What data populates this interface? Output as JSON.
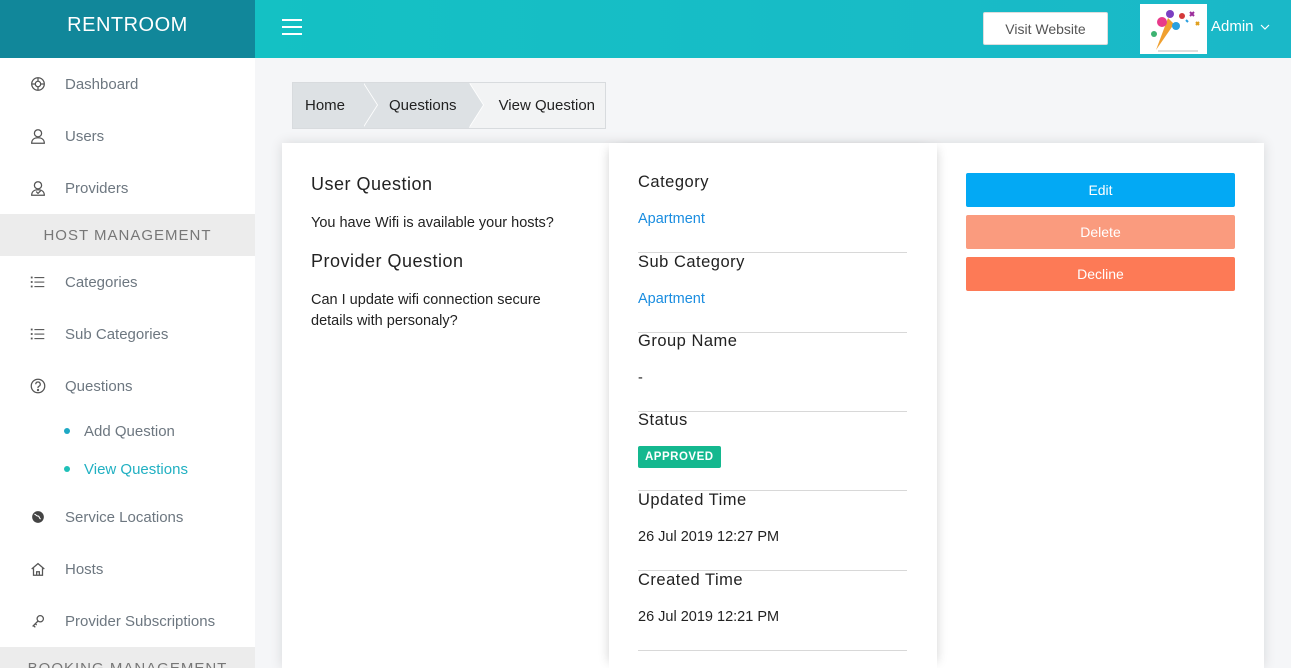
{
  "brand": "RENTROOM",
  "topbar": {
    "visit_website": "Visit Website",
    "admin_label": "Admin"
  },
  "sidebar": {
    "items_top": [
      {
        "label": "Dashboard",
        "icon": "dashboard-icon"
      },
      {
        "label": "Users",
        "icon": "user-icon"
      },
      {
        "label": "Providers",
        "icon": "provider-icon"
      }
    ],
    "host_management": "HOST MANAGEMENT",
    "items_host": [
      {
        "label": "Categories",
        "icon": "list-icon"
      },
      {
        "label": "Sub Categories",
        "icon": "list-icon"
      },
      {
        "label": "Questions",
        "icon": "question-icon"
      }
    ],
    "sub_items": [
      {
        "label": "Add Question"
      },
      {
        "label": "View Questions"
      }
    ],
    "items_more": [
      {
        "label": "Service Locations",
        "icon": "globe-icon"
      },
      {
        "label": "Hosts",
        "icon": "home-icon"
      },
      {
        "label": "Provider Subscriptions",
        "icon": "key-icon"
      }
    ],
    "booking_management": "BOOKING MANAGEMENT"
  },
  "breadcrumb": [
    "Home",
    "Questions",
    "View Question"
  ],
  "question": {
    "user_question_title": "User Question",
    "user_question": "You have Wifi is available your hosts?",
    "provider_question_title": "Provider Question",
    "provider_question": "Can I update wifi connection secure details with personaly?"
  },
  "details": {
    "category_label": "Category",
    "category": "Apartment",
    "sub_category_label": "Sub Category",
    "sub_category": "Apartment",
    "group_name_label": "Group Name",
    "group_name": "-",
    "status_label": "Status",
    "status": "APPROVED",
    "updated_label": "Updated Time",
    "updated": "26 Jul 2019 12:27 PM",
    "created_label": "Created Time",
    "created": "26 Jul 2019 12:21 PM"
  },
  "actions": {
    "edit": "Edit",
    "delete": "Delete",
    "decline": "Decline"
  },
  "colors": {
    "brand_bg": "#11879a",
    "topbar": "#14c1c4",
    "edit": "#03a9f4",
    "delete": "#fa9b7e",
    "decline": "#fd7a56",
    "approved": "#14b88f"
  }
}
